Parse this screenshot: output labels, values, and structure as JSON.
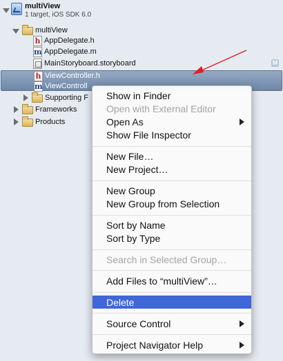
{
  "project": {
    "name": "multiView",
    "subtitle": "1 target, iOS SDK 6.0"
  },
  "tree": {
    "group": "multiView",
    "files": [
      "AppDelegate.h",
      "AppDelegate.m",
      "MainStoryboard.storyboard"
    ],
    "selected": [
      "ViewController.h",
      "ViewControll"
    ],
    "supporting": "Supporting F",
    "frameworks": "Frameworks",
    "products": "Products",
    "modified_badge": "M"
  },
  "menu": {
    "show_in_finder": "Show in Finder",
    "open_external": "Open with External Editor",
    "open_as": "Open As",
    "show_inspector": "Show File Inspector",
    "new_file": "New File…",
    "new_project": "New Project…",
    "new_group": "New Group",
    "new_group_sel": "New Group from Selection",
    "sort_name": "Sort by Name",
    "sort_type": "Sort by Type",
    "search_group": "Search in Selected Group…",
    "add_files": "Add Files to “multiView”…",
    "delete": "Delete",
    "source_control": "Source Control",
    "nav_help": "Project Navigator Help"
  },
  "colors": {
    "highlight": "#3f67d8",
    "arrow": "#e02020",
    "selection": "#7f97b6"
  }
}
